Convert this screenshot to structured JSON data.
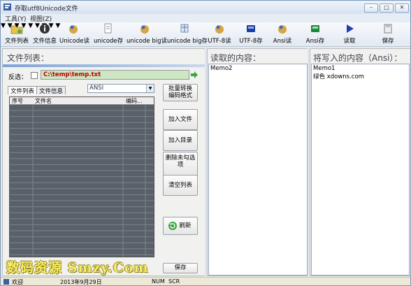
{
  "window": {
    "title": "存取utf8Unicode文件"
  },
  "menu": [
    "工具(Y)",
    "视图(Z)"
  ],
  "toolbar": [
    {
      "label": "文件列表"
    },
    {
      "label": "文件信息"
    },
    {
      "label": "Unicode读"
    },
    {
      "label": "unicode存"
    },
    {
      "label": "unicode big读"
    },
    {
      "label": "unicode big存"
    },
    {
      "label": "UTF-8读"
    },
    {
      "label": "UTF-8存"
    },
    {
      "label": "Ansi读"
    },
    {
      "label": "Ansi存"
    },
    {
      "label": "读取"
    },
    {
      "label": "保存"
    }
  ],
  "left": {
    "heading": "文件列表：",
    "save_path_label": "反选：",
    "path_value": "C:\\temp\\temp.txt",
    "tabs": [
      "文件列表",
      "文件信息"
    ],
    "encoding_selected": "ANSI",
    "columns": [
      "序号",
      "文件名",
      "编码..."
    ],
    "buttons": {
      "batch": "批量转换\n编码格式",
      "add_file": "加入文件",
      "add_dir": "加入目录",
      "delete_unchecked": "删除未勾选\n项",
      "clear": "清空列表",
      "refresh": "刷新",
      "save": "保存"
    },
    "watermark": "数码资源 Smzy.Com"
  },
  "middle": {
    "heading": "读取的内容：",
    "memo": "Memo2"
  },
  "right": {
    "heading": "将写入的内容（Ansi）：",
    "memo_line1": "Memo1",
    "memo_line2": "绿色 xdowns.com"
  },
  "status": {
    "welcome": "欢迎",
    "date": "2013年9月29日",
    "num": "NUM",
    "scr": "SCR"
  }
}
